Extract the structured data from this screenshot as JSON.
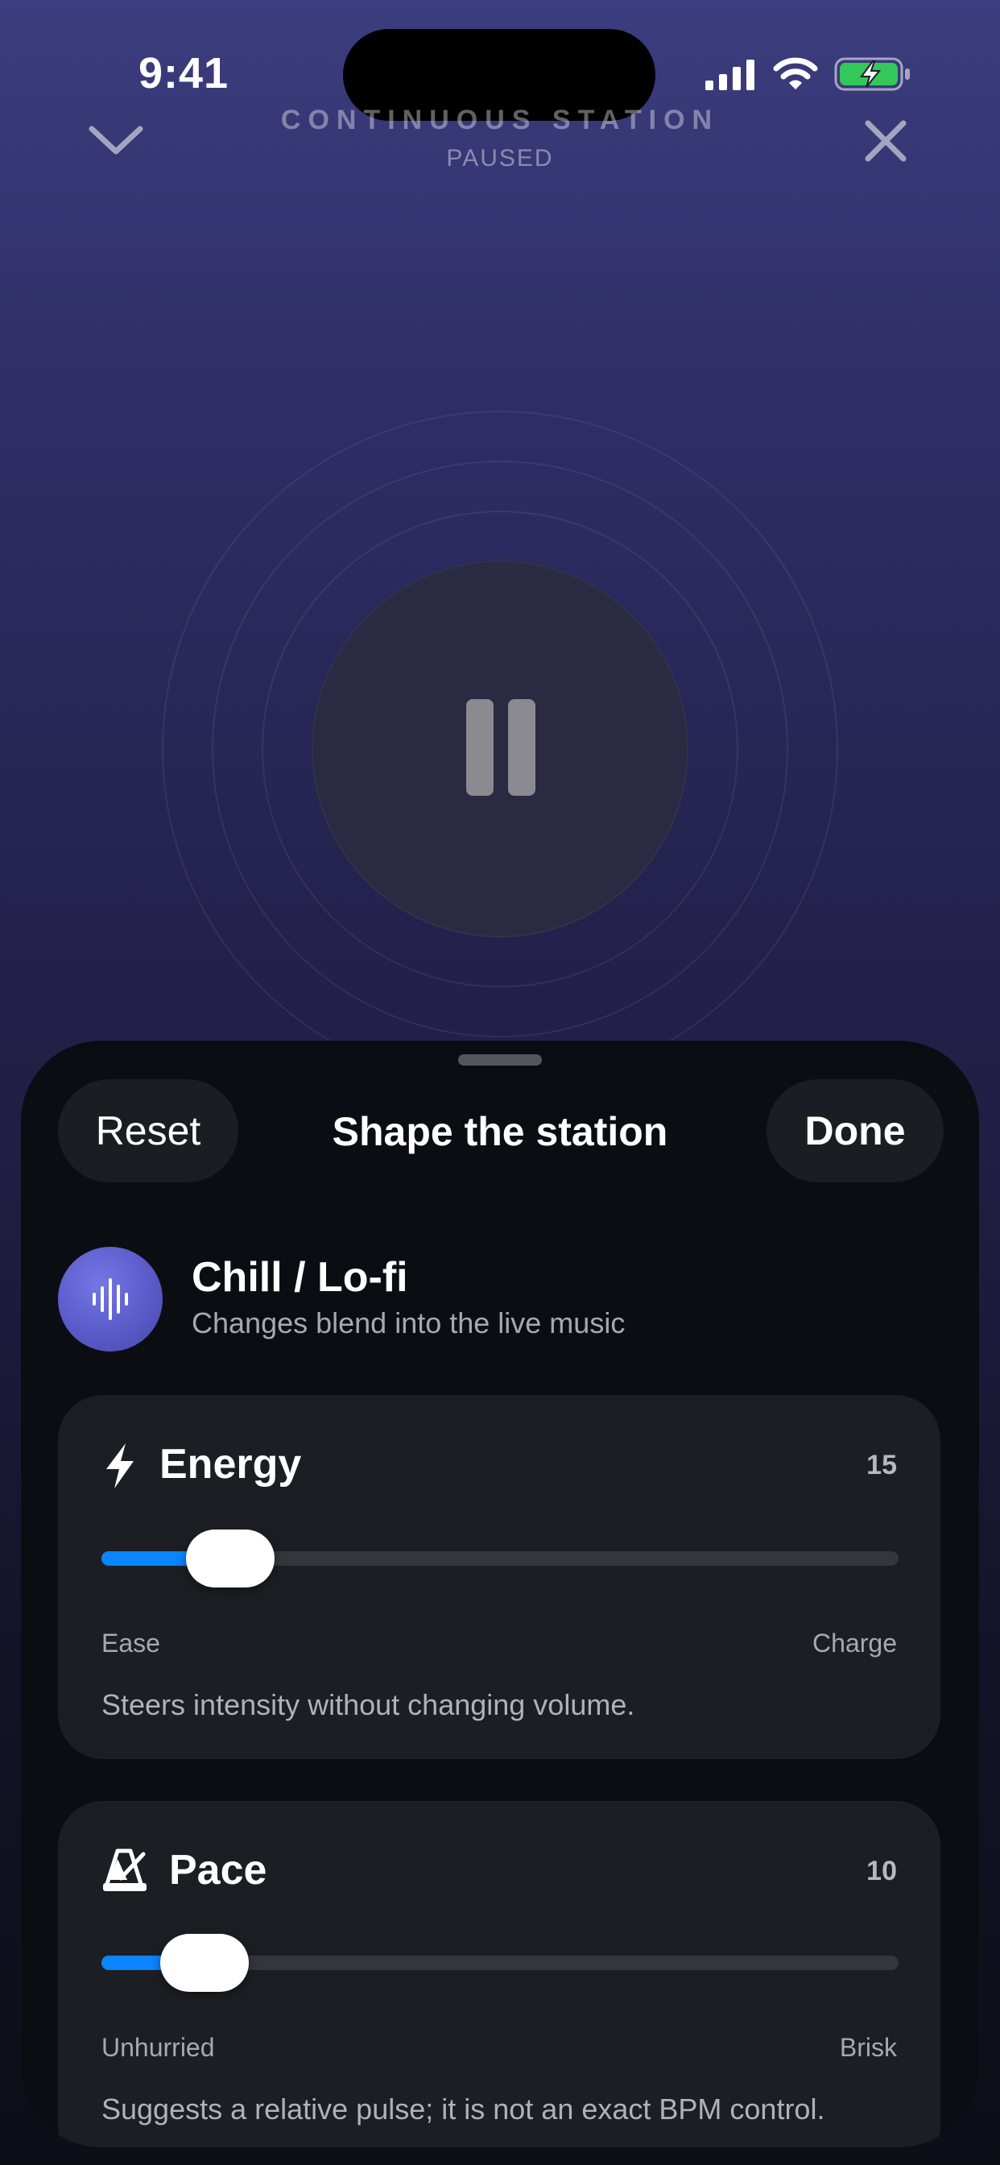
{
  "status_bar": {
    "time": "9:41"
  },
  "header": {
    "title": "CONTINUOUS STATION",
    "subtitle": "PAUSED"
  },
  "sheet": {
    "reset_label": "Reset",
    "title": "Shape the station",
    "done_label": "Done",
    "genre": {
      "name": "Chill / Lo-fi",
      "description": "Changes blend into the live music"
    },
    "controls": [
      {
        "name": "Energy",
        "value": "15",
        "level": 0.15,
        "min_label": "Ease",
        "max_label": "Charge",
        "description": "Steers intensity without changing volume."
      },
      {
        "name": "Pace",
        "value": "10",
        "level": 0.1,
        "min_label": "Unhurried",
        "max_label": "Brisk",
        "description": "Suggests a relative pulse; it is not an exact BPM control."
      }
    ]
  },
  "colors": {
    "accent": "#0a84ff",
    "battery": "#34c759",
    "genre_avatar": "#5a5bc9"
  }
}
